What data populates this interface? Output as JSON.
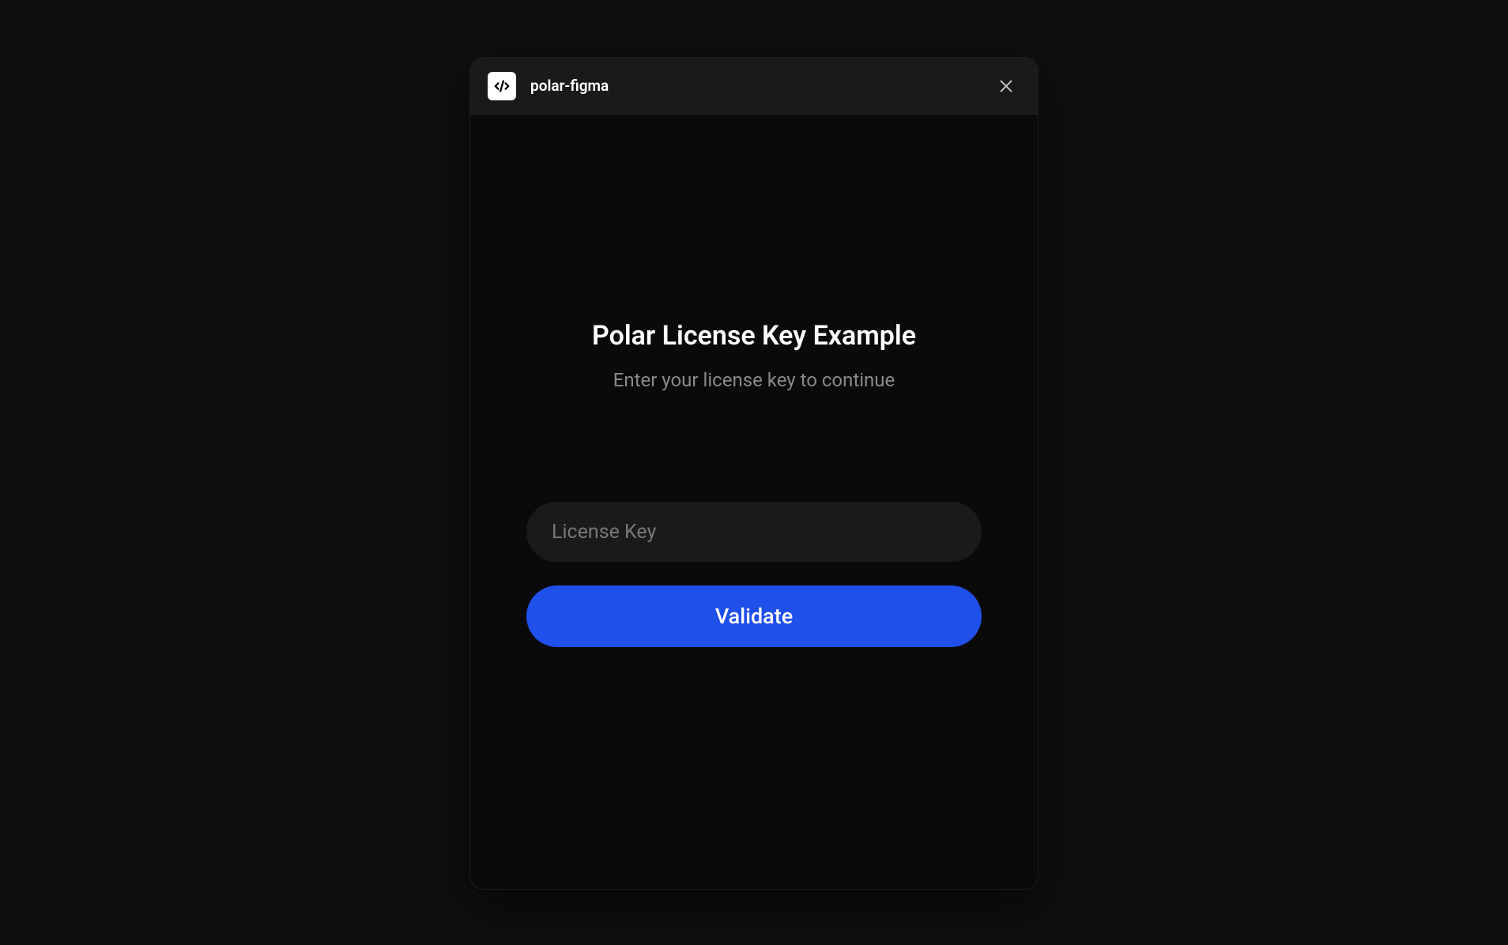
{
  "header": {
    "title": "polar-figma"
  },
  "main": {
    "heading": "Polar License Key Example",
    "subheading": "Enter your license key to continue",
    "input_placeholder": "License Key",
    "input_value": "",
    "button_label": "Validate"
  },
  "colors": {
    "accent": "#2050ea",
    "background": "#0f0f0f",
    "panel": "#0a0a0a",
    "header": "#1a1a1a"
  }
}
